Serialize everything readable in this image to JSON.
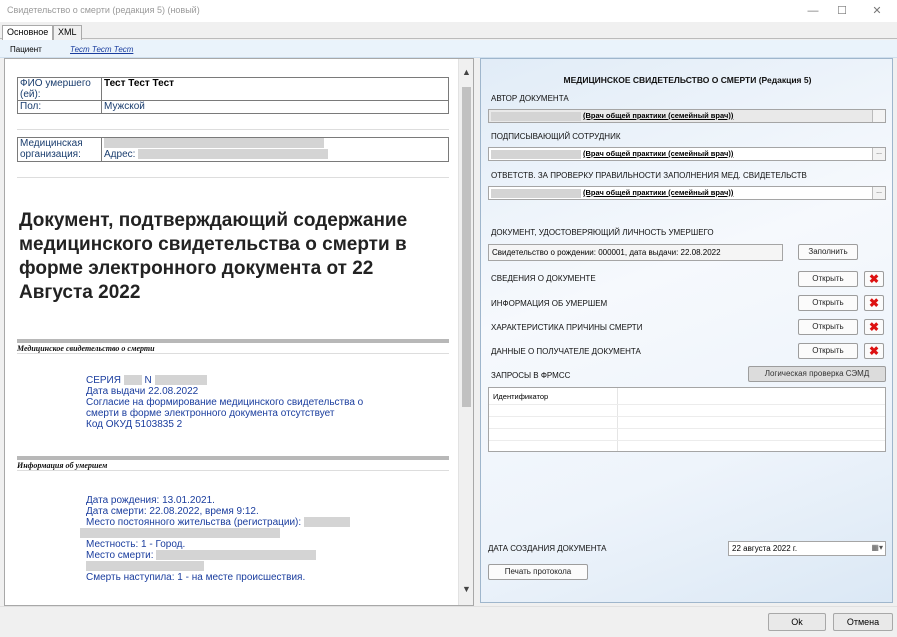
{
  "window": {
    "title": "Свидетельство о смерти (редакция 5) (новый)",
    "minimize": "—",
    "maximize": "☐",
    "close": "✕"
  },
  "tabs": [
    {
      "label": "Основное",
      "active": true
    },
    {
      "label": "XML",
      "active": false
    }
  ],
  "patient": {
    "label": "Пациент",
    "value": "Тест Тест Тест"
  },
  "left": {
    "fio_label": "ФИО умершего (ей):",
    "fio_value": "Тест Тест Тест",
    "sex_label": "Пол:",
    "sex_value": "Мужской",
    "org_label": "Медицинская организация:",
    "address_label": "Адрес:",
    "doc_title": "Документ, подтверждающий содержание медицинского свидетельства о смерти в форме электронного документа от 22 Августа 2022",
    "section1_title": "Медицинское свидетельство о смерти",
    "cert": {
      "seria_label": "СЕРИЯ",
      "n_label": "N",
      "issue_date": "Дата выдачи 22.08.2022",
      "consent_line1": "Согласие на формирование медицинского свидетельства о",
      "consent_line2": "смерти в форме электронного документа отсутствует",
      "okud": "Код ОКУД 5103835 2"
    },
    "section2_title": "Информация об умершем",
    "deceased": {
      "birth": "Дата рождения: 13.01.2021.",
      "death": "Дата смерти: 22.08.2022, время 9:12.",
      "residence": "Место постоянного жительства (регистрации):",
      "locality": "Местность: 1 - Город.",
      "place": "Место смерти:",
      "occurred": "Смерть наступила: 1 - на месте происшествия."
    }
  },
  "right": {
    "title": "МЕДИЦИНСКОЕ СВИДЕТЕЛЬСТВО О СМЕРТИ (Редакция 5)",
    "author_label": "АВТОР ДОКУМЕНТА",
    "author_value": "(Врач общей практики (семейный врач))",
    "signer_label": "ПОДПИСЫВАЮЩИЙ СОТРУДНИК",
    "signer_value": "(Врач общей практики (семейный врач))",
    "resp_label": "ОТВЕТСТВ. ЗА ПРОВЕРКУ ПРАВИЛЬНОСТИ ЗАПОЛНЕНИЯ МЕД. СВИДЕТЕЛЬСТВ",
    "resp_value": "(Врач общей практики (семейный врач))",
    "dots": "...",
    "id_doc_label": "ДОКУМЕНТ, УДОСТОВЕРЯЮЩИЙ ЛИЧНОСТЬ УМЕРШЕГО",
    "id_doc_value": "Свидетельство о рождении: 000001, дата выдачи: 22.08.2022",
    "fill_button": "Заполнить",
    "rows": [
      {
        "label": "СВЕДЕНИЯ О ДОКУМЕНТЕ",
        "button": "Открыть"
      },
      {
        "label": "ИНФОРМАЦИЯ ОБ УМЕРШЕМ",
        "button": "Открыть"
      },
      {
        "label": "ХАРАКТЕРИСТИКА ПРИЧИНЫ СМЕРТИ",
        "button": "Открыть"
      },
      {
        "label": "ДАННЫЕ О ПОЛУЧАТЕЛЕ ДОКУМЕНТА",
        "button": "Открыть"
      }
    ],
    "delete_glyph": "✖",
    "fmss_label": "ЗАПРОСЫ В ФРМСС",
    "logic_check_button": "Логическая проверка СЭМД",
    "grid_header": "Идентификатор",
    "created_label": "ДАТА СОЗДАНИЯ ДОКУМЕНТА",
    "created_value": "22 августа 2022 г.",
    "calendar_glyph": "▦▾",
    "print_button": "Печать протокола"
  },
  "footer": {
    "ok": "Ok",
    "cancel": "Отмена"
  },
  "colors": {
    "link_blue": "#1a3d9e",
    "delete_red": "#dd1111",
    "panel_blue": "#e1ecf7"
  },
  "icons": {
    "scroll_up": "▲",
    "scroll_down": "▼"
  }
}
